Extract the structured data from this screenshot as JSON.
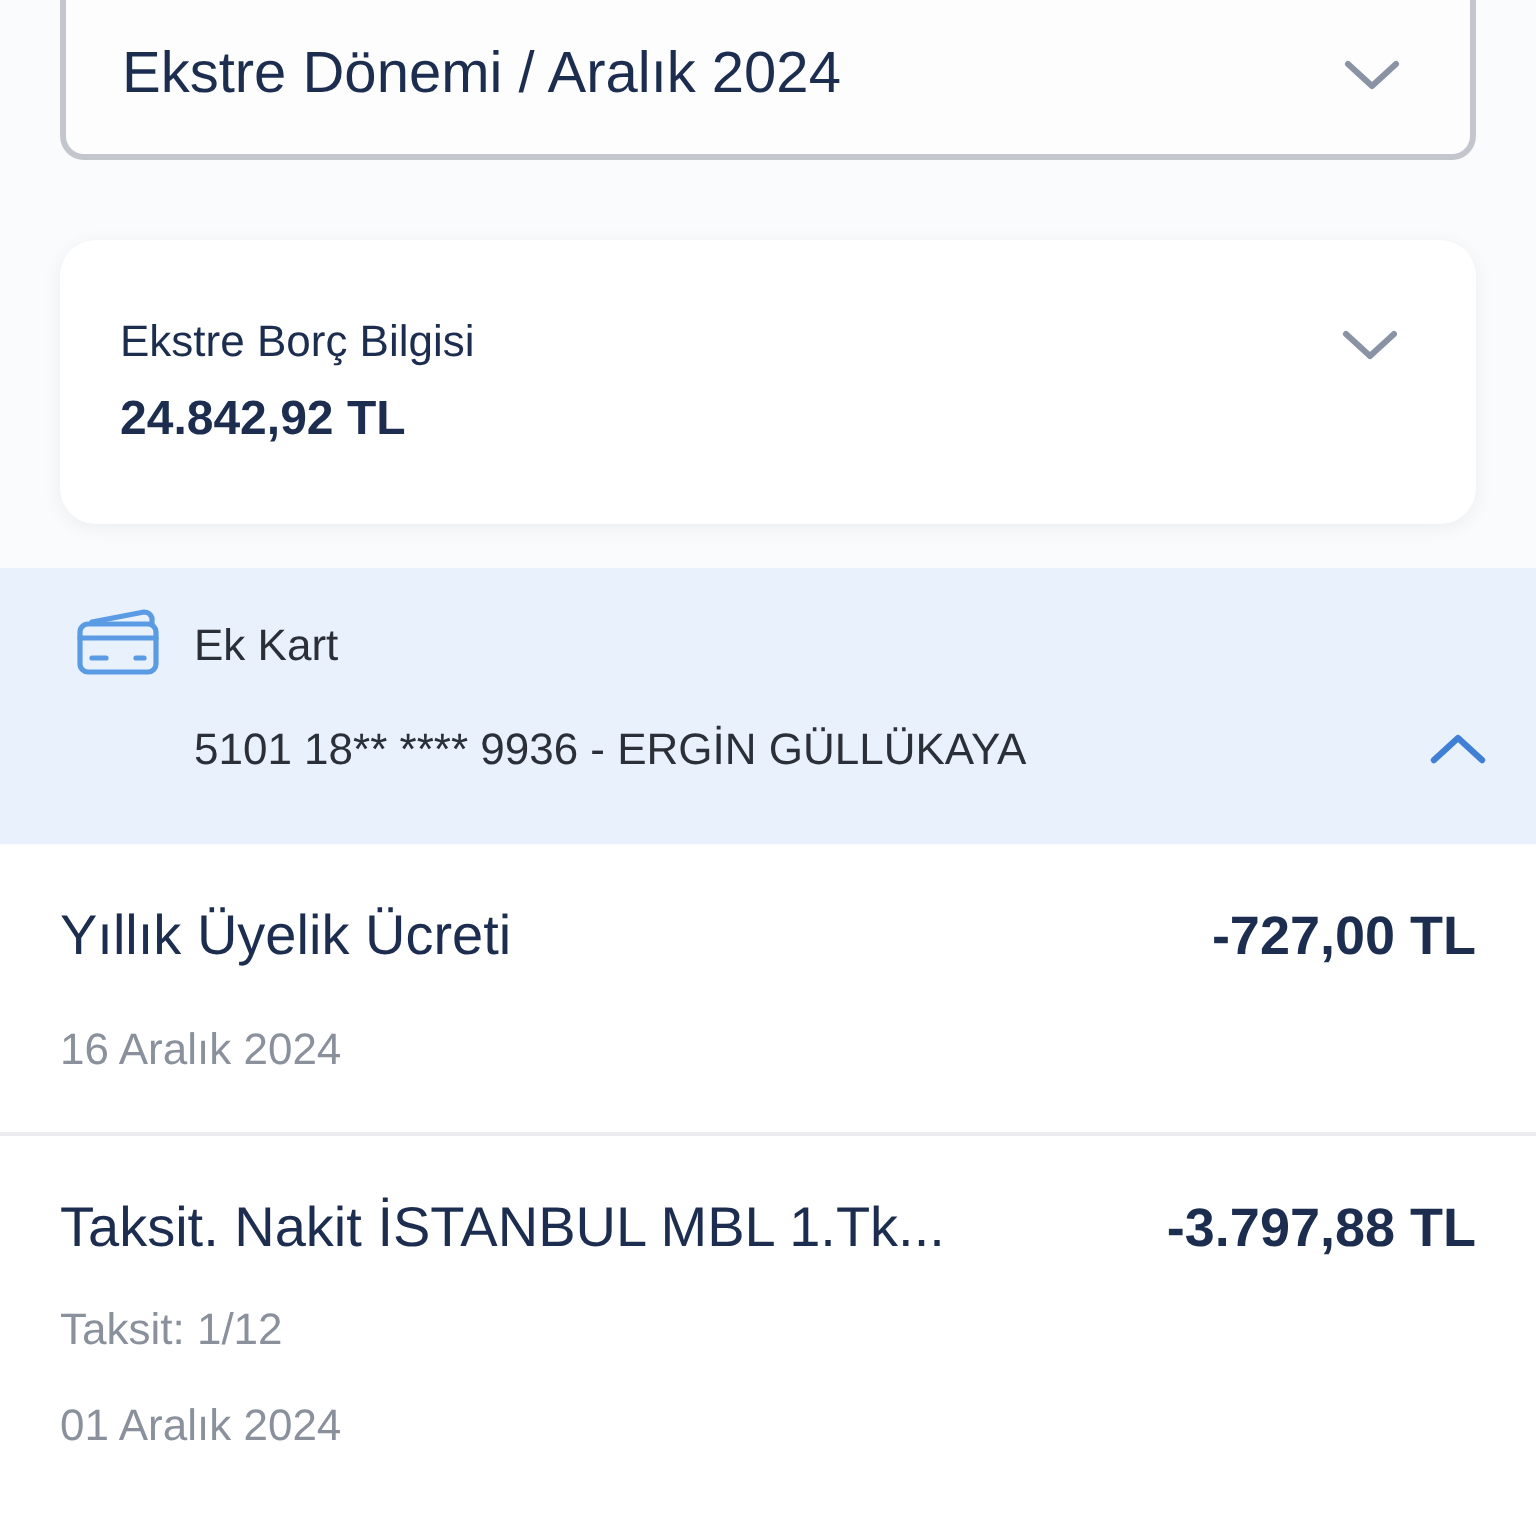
{
  "period_selector": {
    "label": "Ekstre Dönemi / Aralık 2024",
    "expanded": false
  },
  "debt_card": {
    "title": "Ekstre Borç Bilgisi",
    "amount": "24.842,92 TL",
    "expanded": false
  },
  "supplementary_card": {
    "title": "Ek Kart",
    "card_line": "5101 18** **** 9936 - ERGİN GÜLLÜKAYA",
    "expanded": true
  },
  "transactions": [
    {
      "title": "Yıllık Üyelik Ücreti",
      "amount": "-727,00 TL",
      "date": "16 Aralık 2024"
    },
    {
      "title": "Taksit. Nakit İSTANBUL MBL 1.Tk...",
      "amount": "-3.797,88 TL",
      "installment": "Taksit: 1/12",
      "date": "01 Aralık 2024"
    }
  ]
}
